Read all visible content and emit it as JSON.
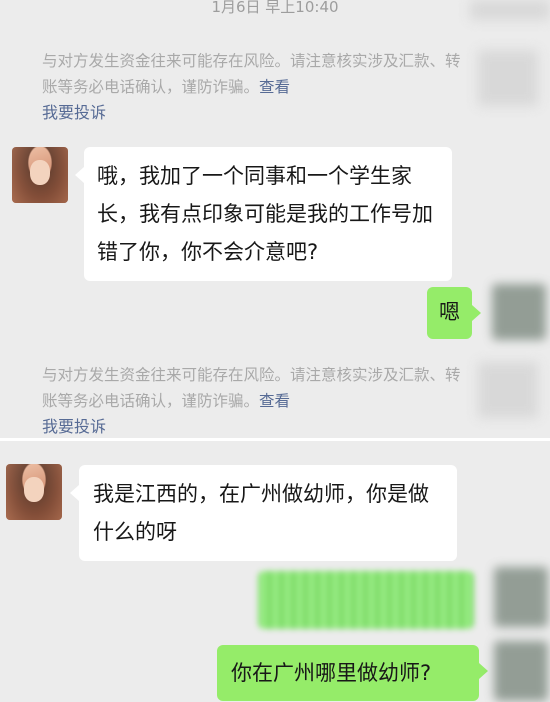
{
  "top": {
    "timestamp": "1月6日 早上10:40",
    "notice_text": "与对方发生资金往来可能存在风险。请注意核实涉及汇款、转账等务必电话确认，谨防诈骗。",
    "notice_link": "查看",
    "complain_link": "我要投诉",
    "message_1": "哦，我加了一个同事和一个学生家长，我有点印象可能是我的工作号加错了你，你不会介意吧?",
    "reply_1": "嗯"
  },
  "bottom": {
    "message_2": "我是江西的，在广州做幼师，你是做什么的呀",
    "reply_3": "你在广州哪里做幼师?"
  },
  "colors": {
    "background": "#ececec",
    "incoming_bubble": "#ffffff",
    "outgoing_bubble": "#95ec69",
    "link": "#576b95",
    "notice_text": "#a9a9a9"
  }
}
